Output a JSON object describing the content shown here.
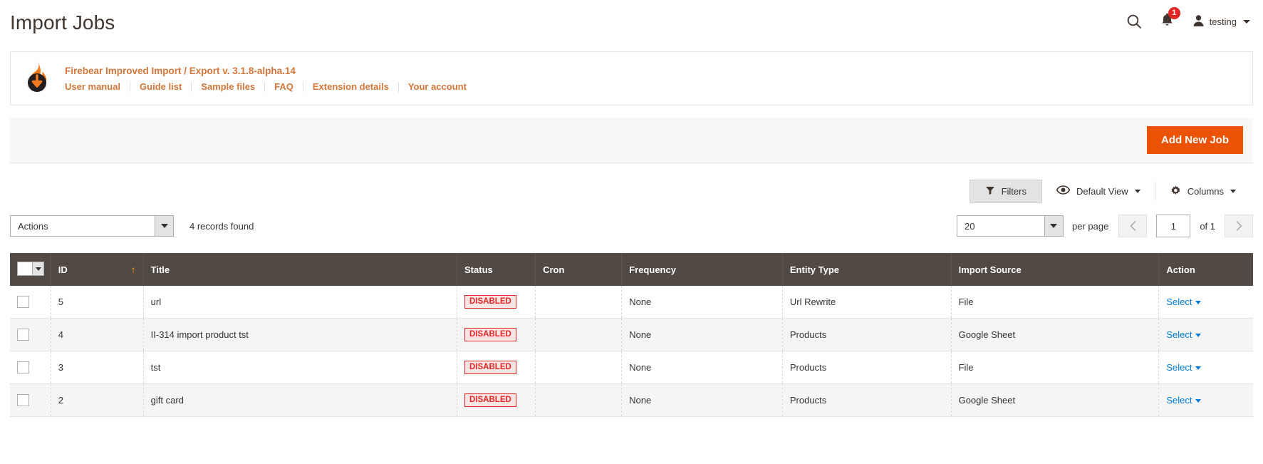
{
  "header": {
    "title": "Import Jobs",
    "search_icon": "search-icon",
    "notification_icon": "bell-icon",
    "notification_count": "1",
    "user_icon": "user-avatar-icon",
    "user_name": "testing"
  },
  "extension_bar": {
    "logo_icon": "firebear-flame-icon",
    "title": "Firebear Improved Import / Export v. 3.1.8-alpha.14",
    "links": [
      {
        "label": "User manual"
      },
      {
        "label": "Guide list"
      },
      {
        "label": "Sample files"
      },
      {
        "label": "FAQ"
      },
      {
        "label": "Extension details"
      },
      {
        "label": "Your account"
      }
    ]
  },
  "action_bar": {
    "add_new_job_label": "Add New Job",
    "accent_color": "#eb5202"
  },
  "grid_controls": {
    "filters_label": "Filters",
    "filters_icon": "funnel-icon",
    "view_label": "Default View",
    "view_icon": "eye-icon",
    "columns_label": "Columns",
    "columns_icon": "gear-icon"
  },
  "toolbar": {
    "actions_label": "Actions",
    "records_found": "4 records found",
    "per_page_value": "20",
    "per_page_label": "per page",
    "page_value": "1",
    "page_of": "of 1",
    "prev_icon": "chevron-left-icon",
    "next_icon": "chevron-right-icon"
  },
  "grid": {
    "header_bg": "#514943",
    "columns": [
      {
        "key": "check",
        "label": ""
      },
      {
        "key": "id",
        "label": "ID",
        "sorted": "asc"
      },
      {
        "key": "title",
        "label": "Title"
      },
      {
        "key": "status",
        "label": "Status"
      },
      {
        "key": "cron",
        "label": "Cron"
      },
      {
        "key": "freq",
        "label": "Frequency"
      },
      {
        "key": "entity",
        "label": "Entity Type"
      },
      {
        "key": "source",
        "label": "Import Source"
      },
      {
        "key": "action",
        "label": "Action"
      }
    ],
    "sort_arrow": "↑",
    "action_label": "Select",
    "rows": [
      {
        "id": "5",
        "title": "url",
        "status": "DISABLED",
        "cron": "",
        "frequency": "None",
        "entity_type": "Url Rewrite",
        "import_source": "File",
        "action": "Select"
      },
      {
        "id": "4",
        "title": "II-314 import product tst",
        "status": "DISABLED",
        "cron": "",
        "frequency": "None",
        "entity_type": "Products",
        "import_source": "Google Sheet",
        "action": "Select"
      },
      {
        "id": "3",
        "title": "tst",
        "status": "DISABLED",
        "cron": "",
        "frequency": "None",
        "entity_type": "Products",
        "import_source": "File",
        "action": "Select"
      },
      {
        "id": "2",
        "title": "gift card",
        "status": "DISABLED",
        "cron": "",
        "frequency": "None",
        "entity_type": "Products",
        "import_source": "Google Sheet",
        "action": "Select"
      }
    ]
  }
}
